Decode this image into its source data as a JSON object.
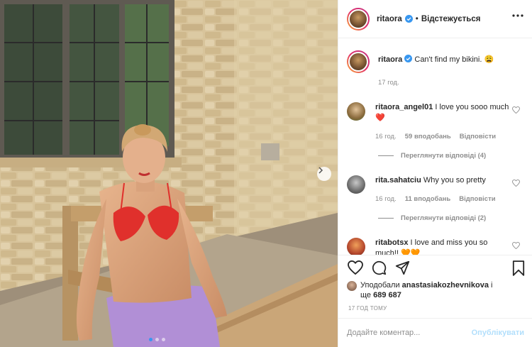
{
  "post": {
    "author": "ritaora",
    "follow_state": "Відстежується",
    "caption_author": "ritaora",
    "caption_text": "Can't find my bikini. 😩",
    "caption_time": "17 год."
  },
  "comments": [
    {
      "user": "ritaora_angel01",
      "text": "I love you sooo much ❤️",
      "time": "16 год.",
      "likes": "59 вподобань",
      "reply": "Відповісти",
      "view_replies": "Переглянути відповіді (4)"
    },
    {
      "user": "rita.sahatciu",
      "text": "Why you so pretty",
      "time": "16 год.",
      "likes": "11 вподобань",
      "reply": "Відповісти",
      "view_replies": "Переглянути відповіді (2)"
    },
    {
      "user": "ritabotsx",
      "text": "I love and miss you so much!! 🧡🧡"
    }
  ],
  "likes": {
    "prefix": "Уподобали",
    "user": "anastasiakozhevnikova",
    "suffix": "і",
    "and": "ще",
    "count": "689 687"
  },
  "post_time": "17 ГОД ТОМУ",
  "composer": {
    "placeholder": "Додайте коментар...",
    "publish_label": "Опублікувати"
  },
  "icons": [
    "heart-icon",
    "comment-icon",
    "share-icon",
    "bookmark-icon",
    "verified-badge-icon",
    "more-options-icon",
    "next-arrow-icon"
  ],
  "colors": {
    "verified": "#3897f0",
    "accent": "#3897f0",
    "publish_disabled": "#b2dffc",
    "heart_red": "#ed4956",
    "muted": "#8e8e8e"
  }
}
